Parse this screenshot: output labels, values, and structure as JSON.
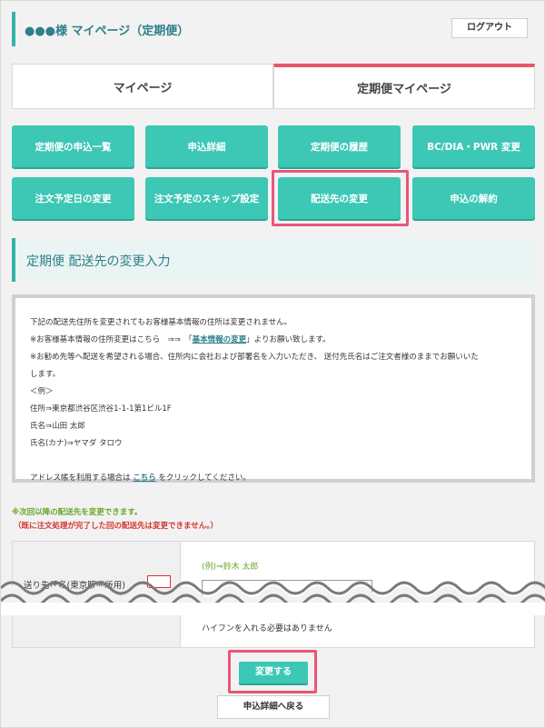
{
  "header": {
    "title": "●●●様 マイページ（定期便）",
    "logout_label": "ログアウト"
  },
  "tabs": [
    {
      "label": "マイページ",
      "active": false
    },
    {
      "label": "定期便マイページ",
      "active": true
    }
  ],
  "menu_buttons": [
    {
      "label": "定期便の申込一覧"
    },
    {
      "label": "申込詳細"
    },
    {
      "label": "定期便の履歴"
    },
    {
      "label": "BC/DIA・PWR 変更"
    },
    {
      "label": "注文予定日の変更"
    },
    {
      "label": "注文予定のスキップ設定"
    },
    {
      "label": "配送先の変更"
    },
    {
      "label": "申込の解約"
    }
  ],
  "section": {
    "title": "定期便 配送先の変更入力"
  },
  "notice": {
    "line1": "下記の配送先住所を変更されてもお客様基本情報の住所は変更されません。",
    "line2_before": "※お客様基本情報の住所変更はこちら　⇒⇒　「",
    "line2_link": "基本情報の変更",
    "line2_after": "」よりお願い致します。",
    "line3": "※お勧め先等へ配送を希望される場合、住所内に会社および部署名を入力いただき、 送付先氏名はご注文者様のままでお願いいた",
    "line4": "します。",
    "line5": "＜例＞",
    "line6": "住所⇒東京都渋谷区渋谷1-1-1第1ビル1F",
    "line7": "氏名⇒山田 太郎",
    "line8": "氏名(カナ)⇒ヤマダ タロウ",
    "line9_before": "アドレス帳を利用する場合は ",
    "line9_link": "こちら",
    "line9_after": " をクリックしてください。"
  },
  "notes": {
    "green": "※次回以降の配送先を変更できます。",
    "red": "（既に注文処理が完了した回の配送先は変更できません。）"
  },
  "form": {
    "label": "送り先氏名(東京販売所用)",
    "example": "(例)⇒鈴木 太郎",
    "input_value": "",
    "hint": "ハイフンを入れる必要はありません"
  },
  "actions": {
    "submit_label": "変更する",
    "back_label": "申込詳細へ戻る"
  },
  "colors": {
    "accent": "#3dc7b5",
    "title_text": "#2d7f8b",
    "highlight": "#e8567a",
    "note_green": "#6aa52a",
    "note_red": "#d5352f"
  }
}
